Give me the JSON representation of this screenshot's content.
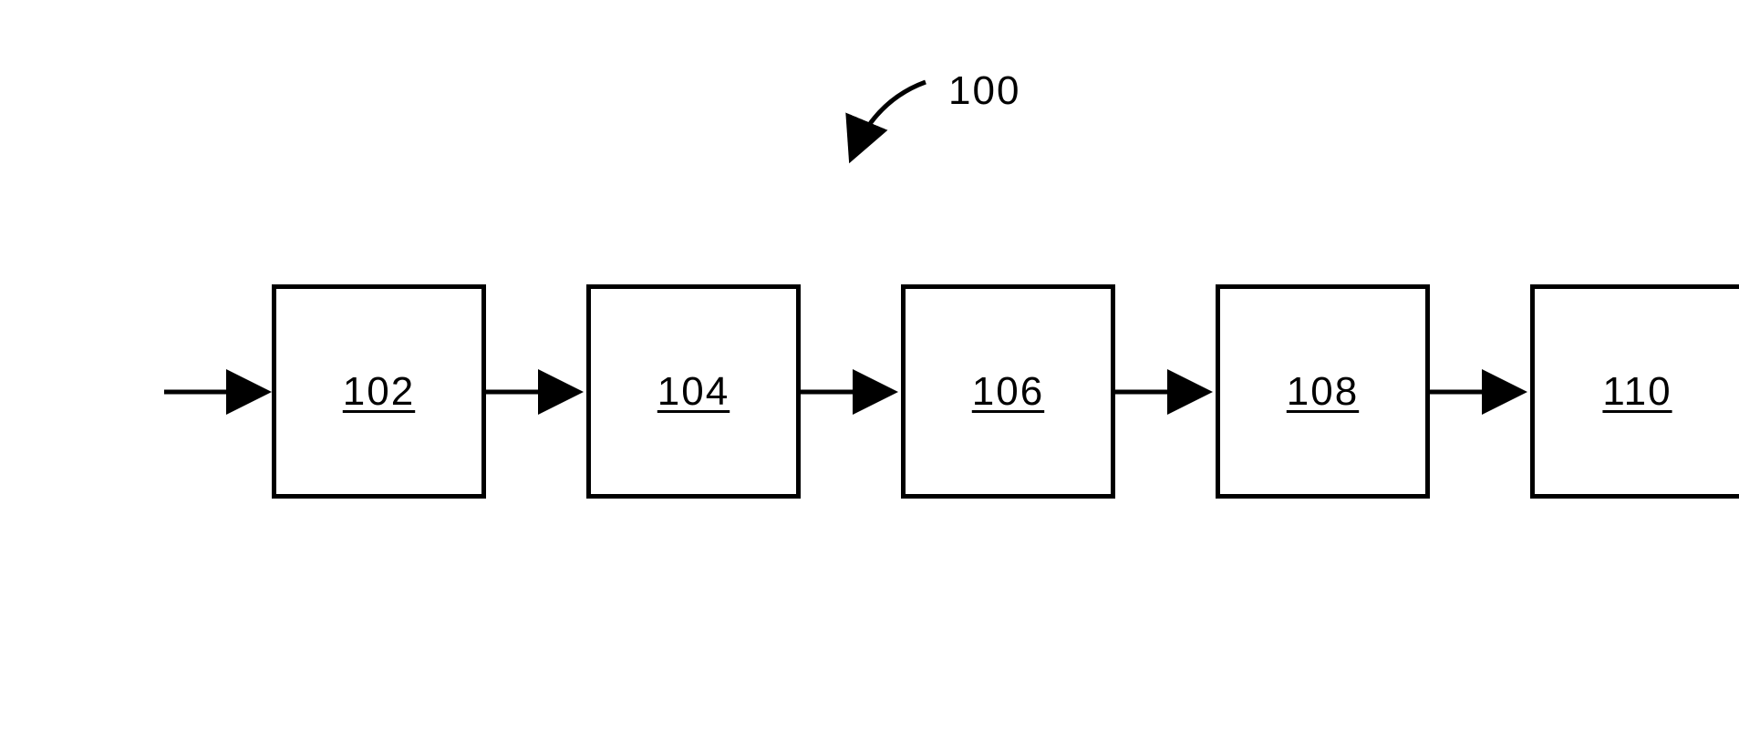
{
  "diagram": {
    "reference_number": "100",
    "blocks": [
      {
        "label": "102"
      },
      {
        "label": "104"
      },
      {
        "label": "106"
      },
      {
        "label": "108"
      },
      {
        "label": "110"
      }
    ]
  }
}
